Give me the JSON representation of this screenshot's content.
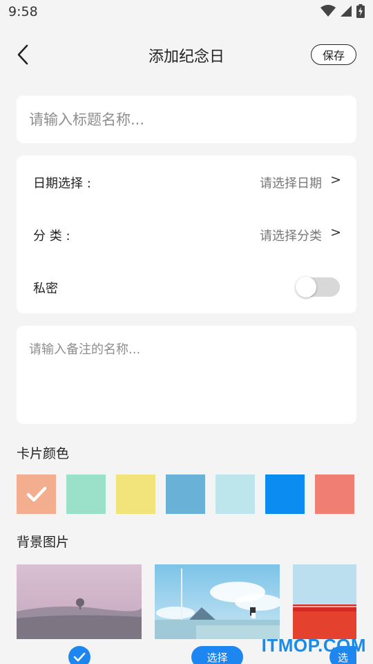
{
  "status_bar": {
    "time": "9:58",
    "icons": [
      "wifi-icon",
      "signal-icon",
      "battery-charging-icon"
    ]
  },
  "app_bar": {
    "back_icon": "chevron-left-icon",
    "title": "添加纪念日",
    "save_label": "保存"
  },
  "title_field": {
    "placeholder": "请输入标题名称...",
    "value": ""
  },
  "options": {
    "date": {
      "label": "日期选择 :",
      "value": "请选择日期",
      "arrow": ">"
    },
    "category": {
      "label": "分 类 :",
      "value": "请选择分类",
      "arrow": ">"
    },
    "private": {
      "label": "私密",
      "enabled": false
    }
  },
  "note_field": {
    "placeholder": "请输入备注的名称...",
    "value": ""
  },
  "card_color": {
    "title": "卡片颜色",
    "selected_index": 0,
    "colors": [
      "#f2ae8e",
      "#9be0c9",
      "#f2e47a",
      "#69b1d6",
      "#bde5ec",
      "#0a8cf0",
      "#f07e72"
    ]
  },
  "background": {
    "title": "背景图片",
    "select_label": "选择",
    "partial_label": "选",
    "selected_index": 0,
    "accent": "#1e86f0"
  },
  "watermark": "ITMOP.COM"
}
